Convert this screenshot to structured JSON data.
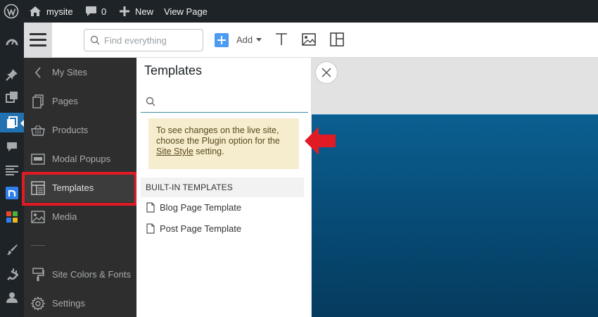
{
  "adminbar": {
    "site_name": "mysite",
    "comments_count": "0",
    "new_label": "New",
    "view_page_label": "View Page"
  },
  "wp_menu_icons": [
    "dashboard-icon",
    "pin-icon",
    "media-icon",
    "pages-icon",
    "comments-icon",
    "format-icon",
    "n-logo-icon",
    "grid-icon",
    "brush-icon",
    "plugin-icon",
    "user-icon"
  ],
  "toolbar": {
    "search_placeholder": "Find everything",
    "add_label": "Add"
  },
  "sidebar": {
    "items": [
      {
        "label": "My Sites",
        "icon": "chevron-left-icon"
      },
      {
        "label": "Pages",
        "icon": "pages-icon"
      },
      {
        "label": "Products",
        "icon": "basket-icon"
      },
      {
        "label": "Modal Popups",
        "icon": "popup-icon"
      },
      {
        "label": "Templates",
        "icon": "template-icon"
      },
      {
        "label": "Media",
        "icon": "image-icon"
      },
      {
        "label": "Site Colors & Fonts",
        "icon": "palette-icon"
      },
      {
        "label": "Settings",
        "icon": "gear-icon"
      }
    ]
  },
  "panel": {
    "title": "Templates",
    "notice_line1": "To see changes on the live site,",
    "notice_line2": "choose the Plugin option for the",
    "notice_link": "Site Style",
    "notice_tail": " setting.",
    "builtin_header": "BUILT-IN TEMPLATES",
    "templates": [
      "Blog Page Template",
      "Post Page Template"
    ]
  },
  "colors": {
    "admin_bg": "#1d2327",
    "accent": "#2271b1",
    "highlight": "#e01b24",
    "sidebar_bg": "#2e2e2e",
    "notice_bg": "#f5edcd",
    "preview_hero": "#0b5f91"
  }
}
